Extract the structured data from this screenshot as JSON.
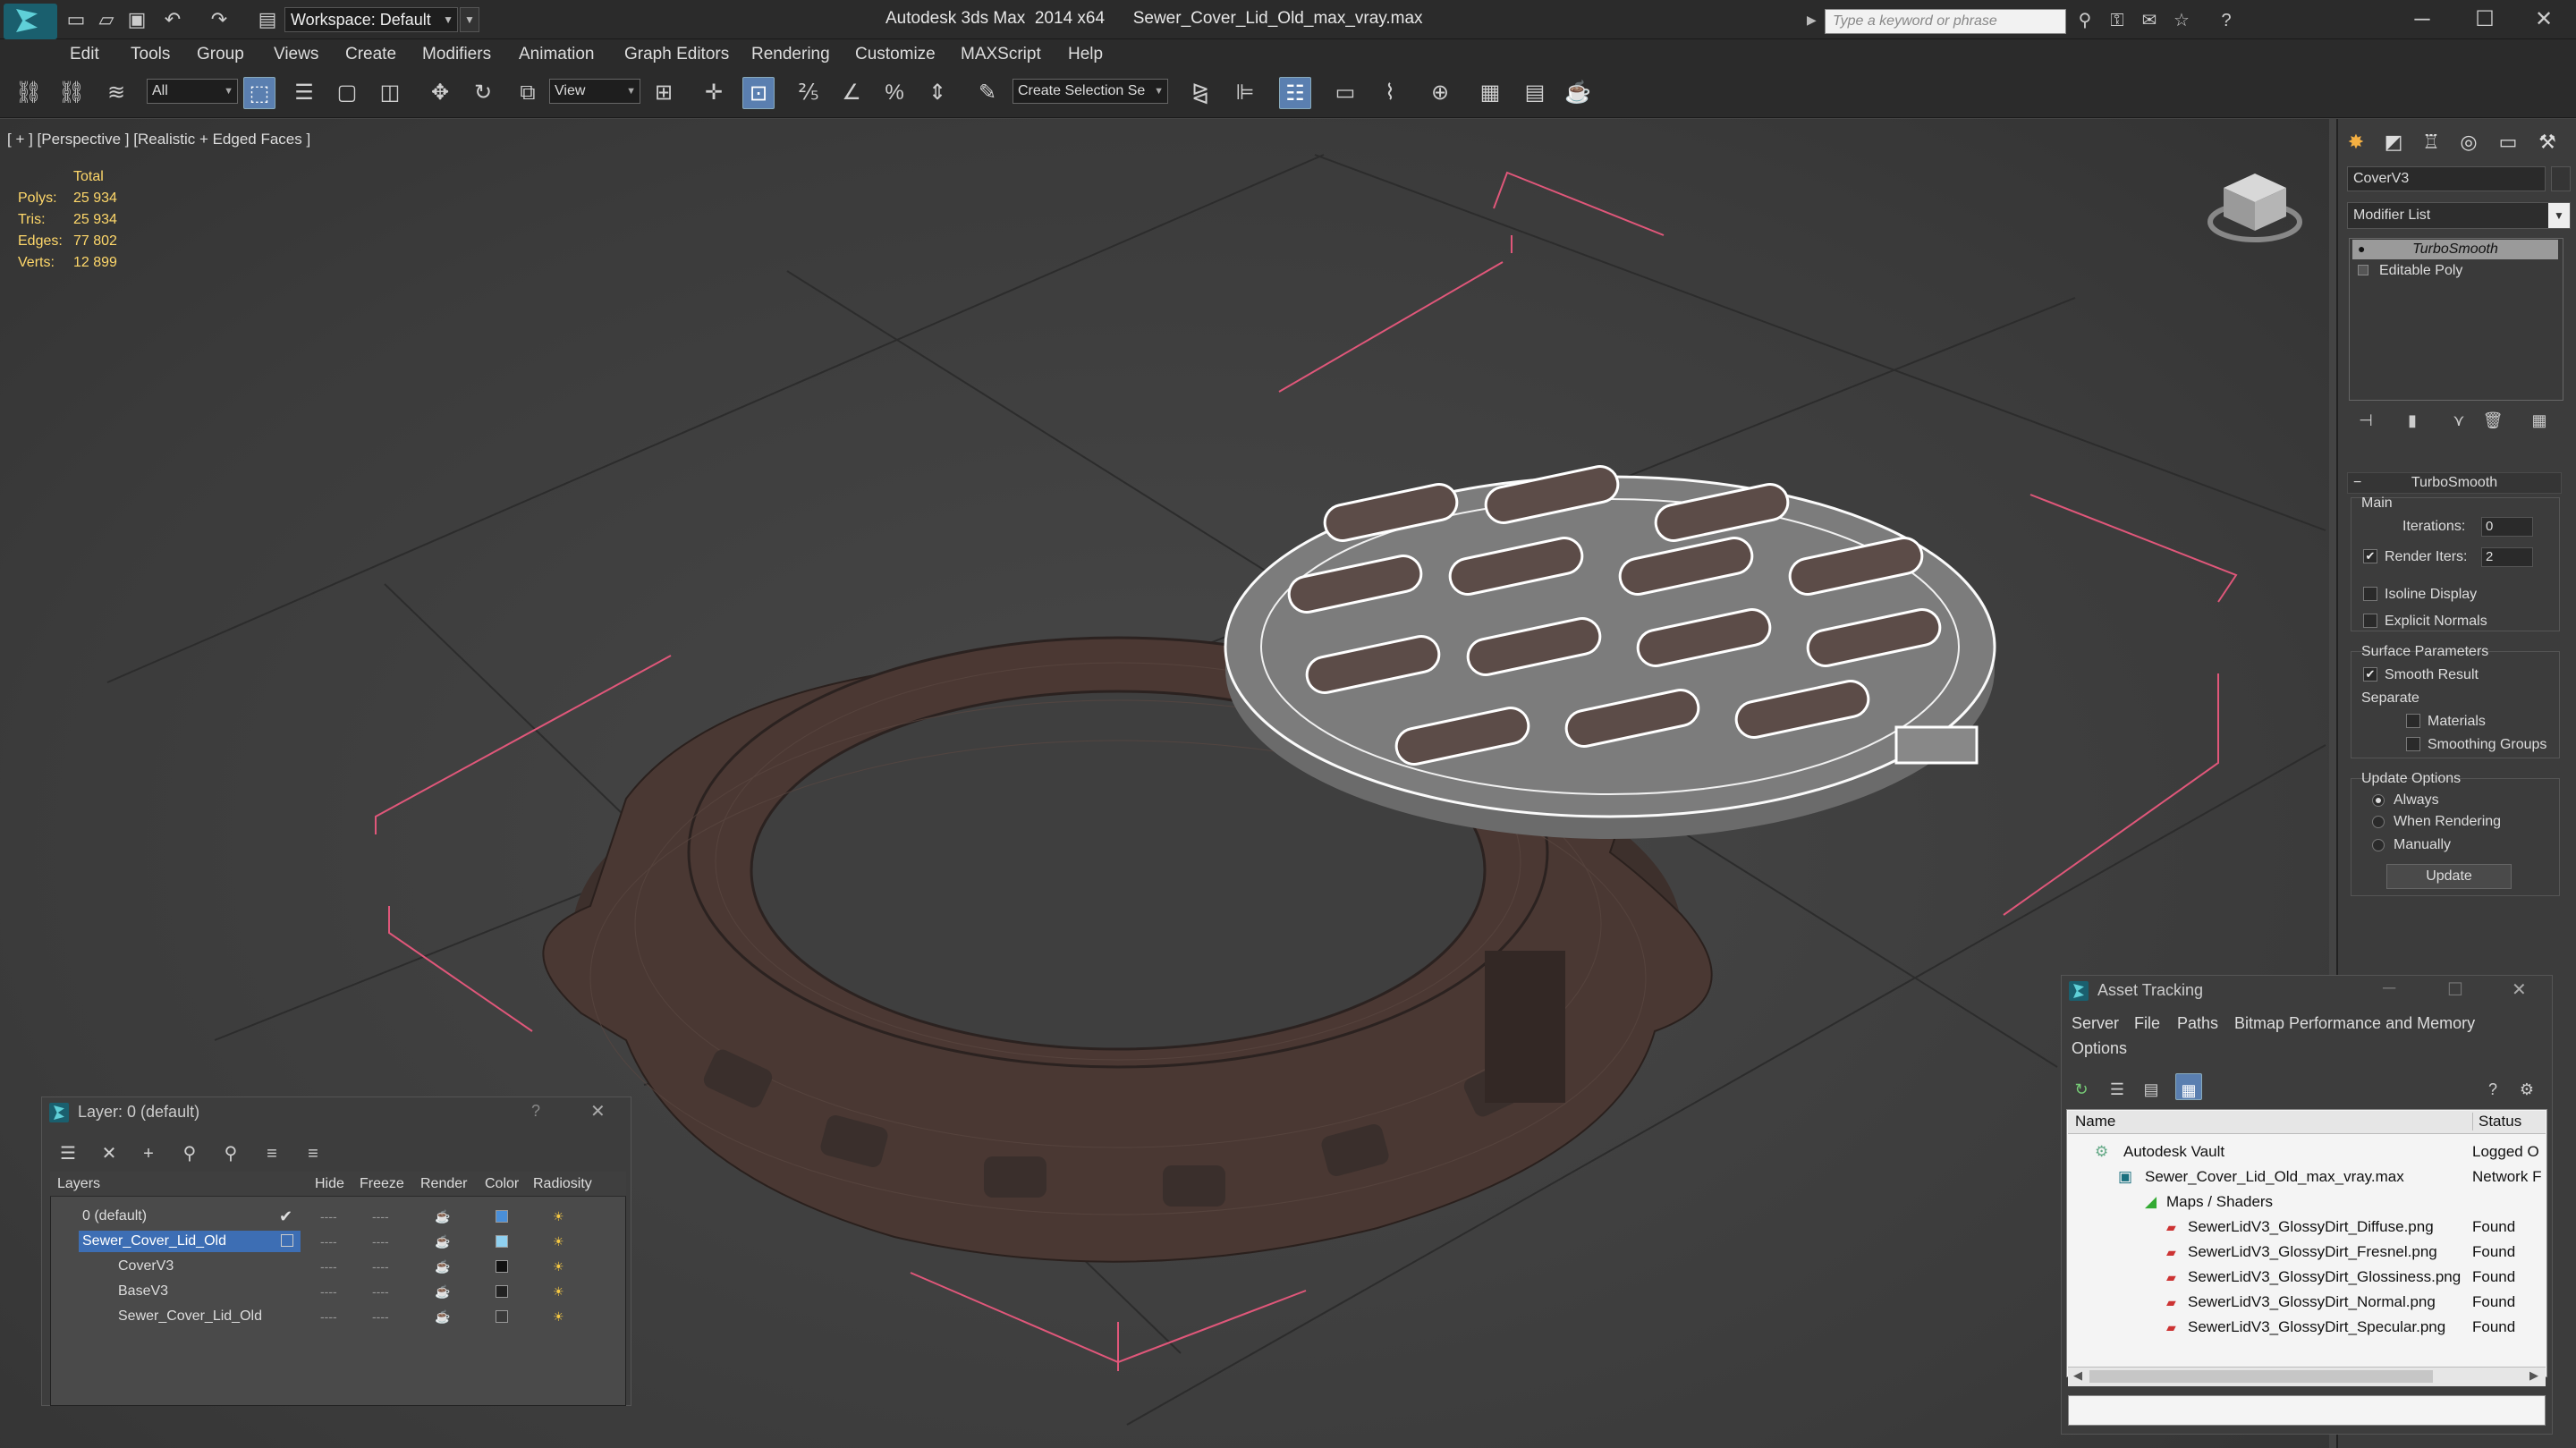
{
  "window": {
    "title": "Autodesk 3ds Max  2014 x64      Sewer_Cover_Lid_Old_max_vray.max",
    "workspace": "Workspace: Default",
    "search_placeholder": "Type a keyword or phrase"
  },
  "menu": [
    "Edit",
    "Tools",
    "Group",
    "Views",
    "Create",
    "Modifiers",
    "Animation",
    "Graph Editors",
    "Rendering",
    "Customize",
    "MAXScript",
    "Help"
  ],
  "toolbar": {
    "filter": "All",
    "ref_coord": "View",
    "selection_set": "Create Selection Se"
  },
  "viewport": {
    "label": "[ + ] [Perspective ] [Realistic + Edged Faces ]",
    "stats": {
      "total_label": "Total",
      "rows": [
        {
          "k": "Polys:",
          "v": "25 934"
        },
        {
          "k": "Tris:",
          "v": "25 934"
        },
        {
          "k": "Edges:",
          "v": "77 802"
        },
        {
          "k": "Verts:",
          "v": "12 899"
        }
      ]
    }
  },
  "command_panel": {
    "object_name": "CoverV3",
    "modifier_list": "Modifier List",
    "stack": [
      "TurboSmooth",
      "Editable Poly"
    ],
    "rollout": {
      "title": "TurboSmooth",
      "main": "Main",
      "iterations_label": "Iterations:",
      "iterations": "0",
      "render_iters_label": "Render Iters:",
      "render_iters": "2",
      "isoline": "Isoline Display",
      "explicit_normals": "Explicit Normals",
      "surface_params": "Surface Parameters",
      "smooth_result": "Smooth Result",
      "separate": "Separate",
      "materials": "Materials",
      "smoothing_groups": "Smoothing Groups",
      "update_options": "Update Options",
      "always": "Always",
      "when_rendering": "When Rendering",
      "manually": "Manually",
      "update_btn": "Update"
    }
  },
  "layer_dialog": {
    "title": "Layer: 0 (default)",
    "help": "?",
    "columns": [
      "Layers",
      "Hide",
      "Freeze",
      "Render",
      "Color",
      "Radiosity"
    ],
    "rows": [
      {
        "name": "0 (default)",
        "color": "#4a8fd8"
      },
      {
        "name": "Sewer_Cover_Lid_Old",
        "color": "#8fd0f0"
      },
      {
        "name": "CoverV3",
        "color": "#111111"
      },
      {
        "name": "BaseV3",
        "color": "#222222"
      },
      {
        "name": "Sewer_Cover_Lid_Old",
        "color": "#3a3a3a"
      }
    ]
  },
  "asset_tracking": {
    "title": "Asset Tracking",
    "menu": [
      "Server",
      "File",
      "Paths",
      "Bitmap Performance and Memory",
      "Options"
    ],
    "columns": [
      "Name",
      "Status"
    ],
    "rows": [
      {
        "name": "Autodesk Vault",
        "status": "Logged O"
      },
      {
        "name": "Sewer_Cover_Lid_Old_max_vray.max",
        "status": "Network F"
      },
      {
        "name": "Maps / Shaders",
        "status": ""
      },
      {
        "name": "SewerLidV3_GlossyDirt_Diffuse.png",
        "status": "Found"
      },
      {
        "name": "SewerLidV3_GlossyDirt_Fresnel.png",
        "status": "Found"
      },
      {
        "name": "SewerLidV3_GlossyDirt_Glossiness.png",
        "status": "Found"
      },
      {
        "name": "SewerLidV3_GlossyDirt_Normal.png",
        "status": "Found"
      },
      {
        "name": "SewerLidV3_GlossyDirt_Specular.png",
        "status": "Found"
      }
    ]
  }
}
